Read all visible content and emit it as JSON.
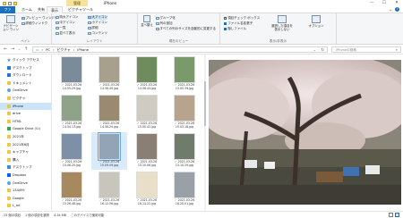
{
  "titlebar": {
    "context_tab": "管理",
    "title": "iPhone",
    "controls": {
      "minimize": "—",
      "maximize": "☐",
      "close": "✕"
    }
  },
  "tabs": {
    "file": "ファイル",
    "home": "ホーム",
    "share": "共有",
    "view": "表示",
    "picture_tools": "ピクチャツール",
    "help": "?"
  },
  "ribbon": {
    "groups": {
      "pane": "ペイン",
      "layout": "レイアウト",
      "current_view": "現在のビュー",
      "show_hide": "表示/非表示"
    },
    "pane_items": {
      "nav_pane": "ナビゲーション ウィンドウ",
      "preview": "プレビュー ウィンドウ",
      "details": "詳細ウィンドウ"
    },
    "layout_items": [
      "特大アイコン",
      "大アイコン",
      "中アイコン",
      "小アイコン",
      "一覧",
      "詳細",
      "並べて表示",
      "コンテンツ"
    ],
    "current_view_items": {
      "sort": "並べ替え",
      "group": "グループ化",
      "add_columns": "列の追加",
      "fit_columns": "すべての列のサイズを自動的に変更する"
    },
    "show_hide_items": {
      "item_checkbox": "項目チェック ボックス",
      "file_ext": "ファイル名拡張子",
      "hidden_items": "隠しファイル",
      "hide_selected": "選択した項目を表示しない",
      "options": "オプション"
    }
  },
  "address": {
    "crumbs": [
      "PC",
      "ピクチャ",
      "iPhone"
    ],
    "search_placeholder": "iPhoneの検索"
  },
  "nav": {
    "items": [
      {
        "label": "クイック アクセス",
        "icon": "star"
      },
      {
        "label": "デスクトップ",
        "icon": "blue"
      },
      {
        "label": "ダウンロード",
        "icon": "blue"
      },
      {
        "label": "ドキュメント",
        "icon": "folder"
      },
      {
        "label": "OneDrive",
        "icon": "cloud"
      },
      {
        "label": "ピクチャ",
        "icon": "folder"
      },
      {
        "label": "iPhone",
        "icon": "folder",
        "selected": true
      },
      {
        "label": "drive",
        "icon": "folder"
      },
      {
        "label": "HTML",
        "icon": "folder"
      },
      {
        "label": "Google Drive (G:)",
        "icon": "gd"
      },
      {
        "label": "2021年",
        "icon": "folder"
      },
      {
        "label": "2021年6月",
        "icon": "folder"
      },
      {
        "label": "キャプチャ",
        "icon": "folder"
      },
      {
        "label": "購入",
        "icon": "folder"
      },
      {
        "label": "デスクトップ",
        "icon": "pc"
      },
      {
        "label": "Dropbox",
        "icon": "drop"
      },
      {
        "label": "OneDrive",
        "icon": "cloud"
      },
      {
        "label": "134495",
        "icon": "folder"
      },
      {
        "label": "Google",
        "icon": "folder"
      },
      {
        "label": "L_mt",
        "icon": "folder"
      }
    ]
  },
  "thumbnails": [
    {
      "line1": "2021-03-26",
      "line2": "14.55.29.jpg",
      "color": "#7c8b9a"
    },
    {
      "line1": "2021-03-26",
      "line2": "14.56.40.jpg",
      "color": "#a7a08c"
    },
    {
      "line1": "2021-03-26",
      "line2": "14.56.44.jpg",
      "color": "#6e8c5e"
    },
    {
      "line1": "2021-03-26",
      "line2": "15.00.39.jpg",
      "color": "#7a9a6b"
    },
    {
      "line1": "2021-03-26",
      "line2": "14.54.13.jpg",
      "color": "#8ea38a"
    },
    {
      "line1": "2021-03-26",
      "line2": "14.56.24.jpg",
      "color": "#9b8a72"
    },
    {
      "line1": "2021-03-26",
      "line2": "15.00.42.jpg",
      "color": "#cfcac2"
    },
    {
      "line1": "2021-03-26",
      "line2": "15.03.18.jpg",
      "color": "#b8a38e"
    },
    {
      "line1": "2021-03-26",
      "line2": "15.06.20.jpg",
      "color": "#7e8fa8"
    },
    {
      "line1": "2021-03-26",
      "line2": "15.09.09.jpg",
      "color": "#93a4b6",
      "selected": true
    },
    {
      "line1": "2021-03-26",
      "line2": "15.10.06.jpg",
      "color": "#8a7f74"
    },
    {
      "line1": "2021-03-26",
      "line2": "15.10.29.jpg",
      "color": "#6f7c6b"
    },
    {
      "line1": "2021-03-26",
      "line2": "15.26.48.jpg",
      "color": "#a7895f"
    },
    {
      "line1": "2021-03-26",
      "line2": "16.12.56.jpg",
      "color": "#c8c5bd"
    },
    {
      "line1": "2021-03-26",
      "line2": "16.14.22.jpg",
      "color": "#e7dfc7"
    },
    {
      "line1": "2021-03-26",
      "line2": "16.20.01.jpg",
      "color": "#9aa0a8"
    }
  ],
  "status": {
    "count": "23 個の項目",
    "selected": "1 個の項目を選択",
    "size": "4.34 MB",
    "sync": "このデバイスで使用可能"
  },
  "colors": {
    "accent": "#1a6fc1",
    "context_tab": "#f6e39a",
    "selection": "#cce4f7"
  }
}
